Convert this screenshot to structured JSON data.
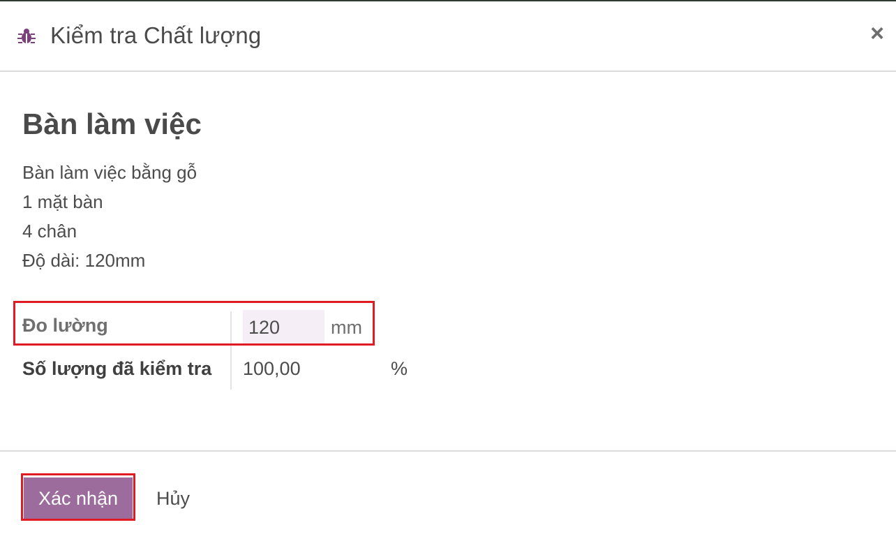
{
  "dialog": {
    "title": "Kiểm tra Chất lượng",
    "icon": "bug-icon",
    "close_label": "×"
  },
  "product": {
    "name": "Bàn làm việc",
    "description_lines": [
      "Bàn làm việc bằng gỗ",
      "1 mặt bàn",
      "4 chân",
      "Độ dài: 120mm"
    ]
  },
  "form": {
    "measure": {
      "label": "Đo lường",
      "value": "120",
      "unit": "mm"
    },
    "checked_qty": {
      "label": "Số lượng đã kiểm tra",
      "value": "100,00",
      "unit": "%"
    }
  },
  "footer": {
    "confirm_label": "Xác nhận",
    "cancel_label": "Hủy"
  },
  "colors": {
    "accent": "#9c6c9c",
    "highlight": "#e01b24",
    "input_bg": "#f6eef6",
    "icon": "#7b3f7b"
  }
}
